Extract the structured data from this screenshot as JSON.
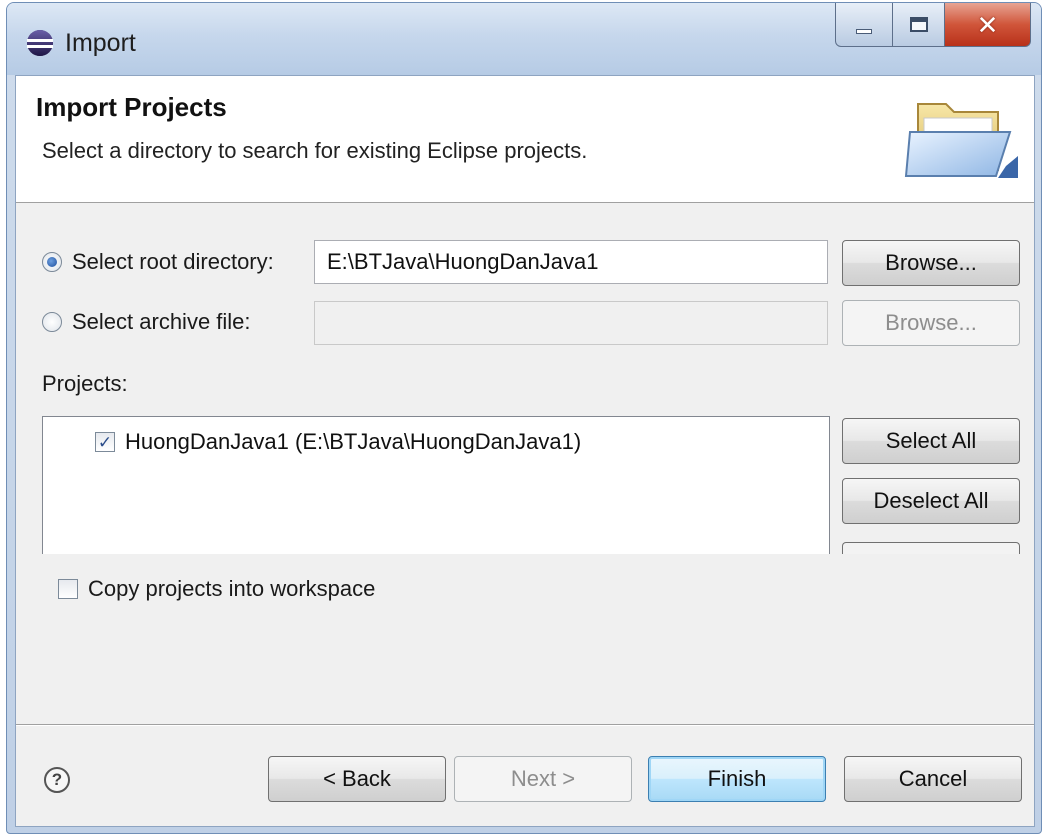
{
  "window": {
    "title": "Import"
  },
  "header": {
    "title": "Import Projects",
    "description": "Select a directory to search for existing Eclipse projects."
  },
  "source": {
    "root_directory_label": "Select root directory:",
    "root_directory_value": "E:\\BTJava\\HuongDanJava1",
    "root_directory_selected": true,
    "archive_file_label": "Select archive file:",
    "archive_file_value": "",
    "archive_file_selected": false,
    "browse_label": "Browse...",
    "browse_archive_label": "Browse..."
  },
  "projects": {
    "label": "Projects:",
    "items": [
      {
        "label": "HuongDanJava1 (E:\\BTJava\\HuongDanJava1)",
        "checked": true
      }
    ],
    "select_all_label": "Select All",
    "deselect_all_label": "Deselect All"
  },
  "options": {
    "copy_into_workspace_label": "Copy projects into workspace",
    "copy_into_workspace_checked": false
  },
  "footer": {
    "help_glyph": "?",
    "back_label": "< Back",
    "next_label": "Next >",
    "finish_label": "Finish",
    "cancel_label": "Cancel"
  },
  "icons": {
    "app": "eclipse-icon",
    "banner": "folder-open-icon",
    "help": "help-icon"
  },
  "colors": {
    "title_bar": "#c6d7ec",
    "close_button": "#d0553a",
    "dialog_background": "#f0f0f0",
    "default_button": "#bee6fd"
  }
}
